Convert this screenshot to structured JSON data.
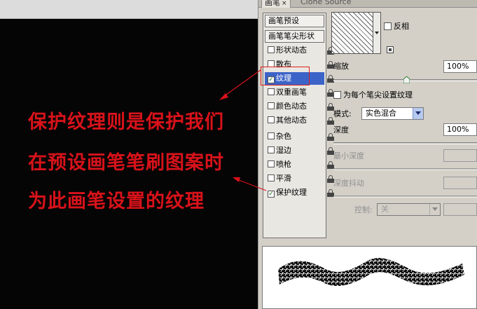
{
  "tabs": [
    {
      "label": "画笔",
      "close": "×"
    },
    {
      "label": "Clone Source"
    }
  ],
  "brush_list": {
    "preset_header": "画笔预设",
    "tip_shape_header": "画笔笔尖形状",
    "items": [
      {
        "label": "形状动态",
        "checked": false
      },
      {
        "label": "散布",
        "checked": false
      },
      {
        "label": "纹理",
        "checked": true,
        "selected": true
      },
      {
        "label": "双重画笔",
        "checked": false
      },
      {
        "label": "颜色动态",
        "checked": false
      },
      {
        "label": "其他动态",
        "checked": false
      },
      {
        "label": "杂色",
        "checked": false
      },
      {
        "label": "湿边",
        "checked": false
      },
      {
        "label": "喷枪",
        "checked": false
      },
      {
        "label": "平滑",
        "checked": false
      },
      {
        "label": "保护纹理",
        "checked": true
      }
    ],
    "check_mark": "✓"
  },
  "texture": {
    "invert_label": "反相",
    "scale_label": "缩放",
    "scale_value": "100%",
    "scale_slider_fraction": 0.5,
    "each_tip_label": "为每个笔尖设置纹理",
    "mode_label": "模式:",
    "mode_value": "实色混合",
    "depth_label": "深度",
    "depth_value": "100%",
    "min_depth_label": "最小深度",
    "depth_jitter_label": "深度抖动",
    "control_label": "控制:",
    "control_value": "关"
  },
  "annotation": {
    "line1": "保护纹理则是保护我们",
    "line2": "在预设画笔笔刷图案时",
    "line3": "为此画笔设置的纹理",
    "color": "#d8121a"
  }
}
